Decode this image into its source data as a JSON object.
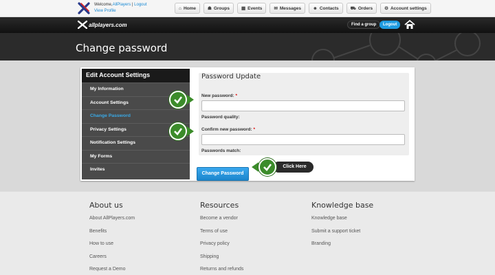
{
  "topbar": {
    "welcome_prefix": "Welcome,",
    "user": "AllPlayers",
    "separator": " | ",
    "logout": "Logout",
    "view_profile": "View Profile",
    "nav": [
      {
        "label": "Home",
        "icon": "home-icon",
        "glyph": "⌂"
      },
      {
        "label": "Groups",
        "icon": "groups-icon",
        "glyph": "☗"
      },
      {
        "label": "Events",
        "icon": "calendar-icon",
        "glyph": "▦"
      },
      {
        "label": "Messages",
        "icon": "envelope-icon",
        "glyph": "✉"
      },
      {
        "label": "Contacts",
        "icon": "contacts-icon",
        "glyph": "☻"
      },
      {
        "label": "Orders",
        "icon": "cart-icon",
        "glyph": "⛟"
      },
      {
        "label": "Account settings",
        "icon": "settings-icon",
        "glyph": "⚙"
      }
    ]
  },
  "header": {
    "brand": "allplayers.com",
    "find_group": "Find a group",
    "logout": "Logout"
  },
  "hero": {
    "title": "Change password"
  },
  "sidebar": {
    "title": "Edit Account Settings",
    "items": [
      {
        "label": "My Information"
      },
      {
        "label": "Account Settings"
      },
      {
        "label": "Change Password"
      },
      {
        "label": "Privacy Settings"
      },
      {
        "label": "Notification Settings"
      },
      {
        "label": "My Forms"
      },
      {
        "label": "Invites"
      }
    ],
    "active_index": 2
  },
  "form": {
    "legend": "Password Update",
    "new_password_label": "New password:",
    "required_mark": "*",
    "password_quality_label": "Password quality:",
    "confirm_label": "Confirm new password:",
    "passwords_match_label": "Passwords match:",
    "submit": "Change Password",
    "click_here": "Click Here"
  },
  "footer": {
    "columns": [
      {
        "title": "About us",
        "links": [
          "About AllPlayers.com",
          "Benefits",
          "How to use",
          "Careers",
          "Request a Demo"
        ]
      },
      {
        "title": "Resources",
        "links": [
          "Become a vendor",
          "Terms of use",
          "Privacy policy",
          "Shipping",
          "Returns and refunds"
        ]
      },
      {
        "title": "Knowledge base",
        "links": [
          "Knowledge base",
          "Submit a support ticket",
          "Branding"
        ]
      }
    ]
  },
  "colors": {
    "accent": "#1f9be0",
    "check_green": "#3b8c2a",
    "header_black": "#111111"
  }
}
